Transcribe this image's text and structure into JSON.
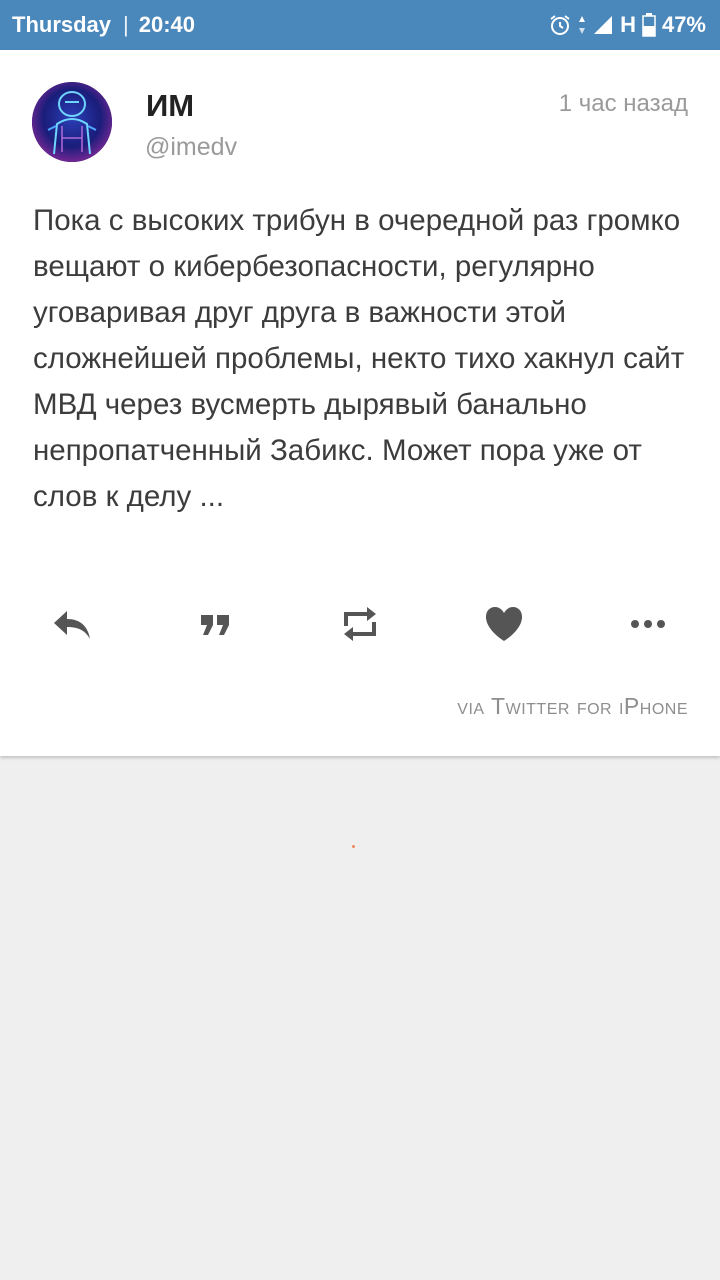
{
  "status_bar": {
    "day": "Thursday",
    "separator": "|",
    "time": "20:40",
    "network": "H",
    "battery": "47%"
  },
  "tweet": {
    "name": "ИМ",
    "handle": "@imedv",
    "time_ago": "1 час назад",
    "text": "Пока с высоких трибун в очередной раз громко вещают о кибербезопасности, регулярно уговаривая друг друга в важности этой сложнейшей проблемы, некто тихо хакнул сайт МВД через вусмерть дырявый банально непропатченный Забикс. Может пора уже от слов к делу ...",
    "source": "via Twitter for iPhone"
  },
  "actions": [
    {
      "icon": "reply-icon"
    },
    {
      "icon": "quote-icon"
    },
    {
      "icon": "retweet-icon"
    },
    {
      "icon": "heart-icon"
    },
    {
      "icon": "more-icon"
    }
  ],
  "colors": {
    "status_bar": "#4a87bb",
    "card": "#ffffff",
    "background": "#efefef",
    "icon": "#555555"
  }
}
